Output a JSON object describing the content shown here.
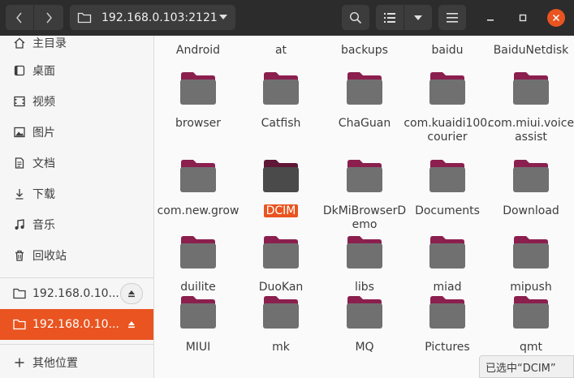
{
  "header": {
    "path": "192.168.0.103:2121"
  },
  "sidebar": {
    "places": [
      {
        "label": "主目录",
        "icon": "home-icon"
      },
      {
        "label": "桌面",
        "icon": "desktop-icon"
      },
      {
        "label": "视频",
        "icon": "video-icon"
      },
      {
        "label": "图片",
        "icon": "picture-icon"
      },
      {
        "label": "文档",
        "icon": "document-icon"
      },
      {
        "label": "下载",
        "icon": "download-icon"
      },
      {
        "label": "音乐",
        "icon": "music-icon"
      },
      {
        "label": "回收站",
        "icon": "trash-icon"
      }
    ],
    "mounts": [
      {
        "label": "192.168.0.10...",
        "active": false
      },
      {
        "label": "192.168.0.10...",
        "active": true
      }
    ],
    "other_locations": "其他位置"
  },
  "files": [
    {
      "name": "Android"
    },
    {
      "name": "at"
    },
    {
      "name": "backups"
    },
    {
      "name": "baidu"
    },
    {
      "name": "BaiduNetdisk"
    },
    {
      "name": "browser"
    },
    {
      "name": "Catfish"
    },
    {
      "name": "ChaGuan"
    },
    {
      "name": "com.kuaidi100.courier"
    },
    {
      "name": "com.miui.voiceassist"
    },
    {
      "name": "com.new.grow"
    },
    {
      "name": "DCIM",
      "selected": true
    },
    {
      "name": "DkMiBrowserDemo"
    },
    {
      "name": "Documents"
    },
    {
      "name": "Download"
    },
    {
      "name": "duilite"
    },
    {
      "name": "DuoKan"
    },
    {
      "name": "libs"
    },
    {
      "name": "miad"
    },
    {
      "name": "mipush"
    },
    {
      "name": "MIUI"
    },
    {
      "name": "mk"
    },
    {
      "name": "MQ"
    },
    {
      "name": "Pictures"
    },
    {
      "name": "qmt"
    }
  ],
  "status": "已选中“DCIM”",
  "colors": {
    "accent": "#e95420",
    "header_bg": "#2c2c2c",
    "folder_body": "#707070",
    "folder_tab": "#8b1f4e"
  }
}
